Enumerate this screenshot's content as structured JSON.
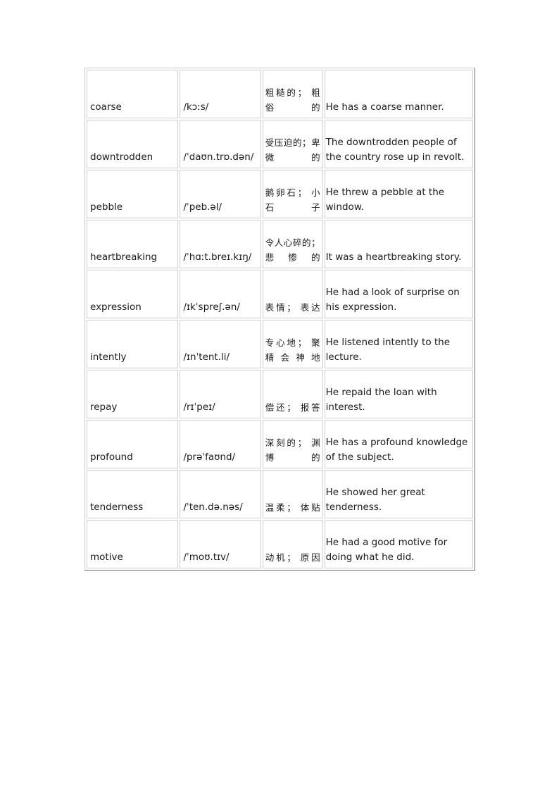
{
  "table": {
    "rows": [
      {
        "word": "coarse",
        "ipa": "/kɔːs/",
        "meaning": "粗糙的； 粗俗的",
        "example": "He has a coarse manner."
      },
      {
        "word": "downtrodden",
        "ipa": "/ˈdaʊn.trɒ.dən/",
        "meaning": "受压迫的；卑微的",
        "example": "The downtrodden people of the country rose up in revolt."
      },
      {
        "word": "pebble",
        "ipa": "/ˈpeb.əl/",
        "meaning": "鹅卵石； 小石子",
        "example": "He threw a pebble at the window."
      },
      {
        "word": "heartbreaking",
        "ipa": "/ˈhɑːt.breɪ.kɪŋ/",
        "meaning": "令人心碎的； 悲惨的",
        "example": "It was a heartbreaking story."
      },
      {
        "word": "expression",
        "ipa": "/ɪkˈspreʃ.ən/",
        "meaning": "表情； 表达",
        "example": "He had a look of surprise on his expression."
      },
      {
        "word": "intently",
        "ipa": "/ɪnˈtent.li/",
        "meaning": "专心地； 聚精会神地",
        "example": "He listened intently to the lecture."
      },
      {
        "word": "repay",
        "ipa": "/rɪˈpeɪ/",
        "meaning": "偿还； 报答",
        "example": "He repaid the loan with interest."
      },
      {
        "word": "profound",
        "ipa": "/prəˈfaʊnd/",
        "meaning": "深刻的； 渊博的",
        "example": "He has a profound knowledge of the subject."
      },
      {
        "word": "tenderness",
        "ipa": "/ˈten.də.nəs/",
        "meaning": "温柔； 体贴",
        "example": "He showed her great tenderness."
      },
      {
        "word": "motive",
        "ipa": "/ˈmoʊ.tɪv/",
        "meaning": "动机； 原因",
        "example": "He had a good motive for doing what he did."
      }
    ]
  }
}
